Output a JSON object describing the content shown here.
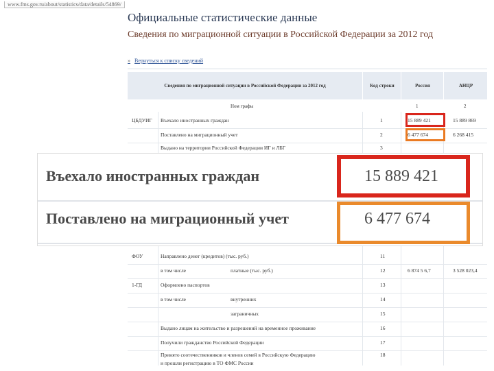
{
  "browser": {
    "url": "www.fms.gov.ru/about/statistics/data/details/54869/"
  },
  "page": {
    "title": "Официальные статистические данные",
    "subtitle": "Сведения по миграционной ситуации в Российской Федерации за 2012 год",
    "back_link": "Вернуться к списку сведений"
  },
  "table": {
    "headers": {
      "indicator": "Сведения по миграционной ситуации в Российской Федерации за 2012 год",
      "code": "Код строки",
      "russia": "Россия",
      "ancr": "АНЦР"
    },
    "column_numbers": {
      "indicator": "Ном графы",
      "code": "1",
      "russia": "2"
    },
    "rows": [
      {
        "group": "ЦБДУИГ",
        "label": "Въехало иностранных граждан",
        "code": "1",
        "russia": "15 889 421",
        "ancr": "15 889 869"
      },
      {
        "group": "",
        "label": "Поставлено на миграционный учет",
        "code": "2",
        "russia": "6 477 674",
        "ancr": "6 268 415"
      },
      {
        "group": "",
        "label": "Выдано на территории Российской Федерации ИГ и ЛБГ",
        "code": "3",
        "russia": "",
        "ancr": ""
      },
      {
        "group": "ФОУ",
        "label": "Направлено денег (кредитов) (тыс. руб.)",
        "code": "11",
        "russia": "",
        "ancr": ""
      },
      {
        "group": "",
        "label": "в том числе",
        "sublabel": "платные (тыс. руб.)",
        "code": "12",
        "russia": "6 874 5 6,7",
        "ancr": "3 528 023,4"
      },
      {
        "group": "1-ГД",
        "label": "Оформлено паспортов",
        "code": "13",
        "russia": "",
        "ancr": ""
      },
      {
        "group": "",
        "label": "в том числе",
        "sublabel": "внутренних",
        "code": "14",
        "russia": "",
        "ancr": ""
      },
      {
        "group": "",
        "label": "",
        "sublabel": "заграничных",
        "code": "15",
        "russia": "",
        "ancr": ""
      },
      {
        "group": "",
        "label": "Выдано лицам на жительство и разрешений на временное проживание",
        "code": "16",
        "russia": "",
        "ancr": ""
      },
      {
        "group": "",
        "label": "Получили гражданство Российской Федерации",
        "code": "17",
        "russia": "",
        "ancr": ""
      },
      {
        "group": "",
        "label": "Принято соотечественников и членов семей в Российскую Федерацию",
        "code": "18",
        "russia": "",
        "ancr": ""
      },
      {
        "group": "",
        "label": "и прошли регистрацию в ТО ФМС России",
        "code": "",
        "russia": "",
        "ancr": ""
      }
    ]
  },
  "zoom": {
    "row1_label": "Въехало иностранных граждан",
    "row1_value": "15 889 421",
    "row2_label": "Поставлено на миграционный учет",
    "row2_value": "6 477 674"
  },
  "colors": {
    "highlight_red": "#d9261c",
    "highlight_orange": "#ea7a22"
  }
}
